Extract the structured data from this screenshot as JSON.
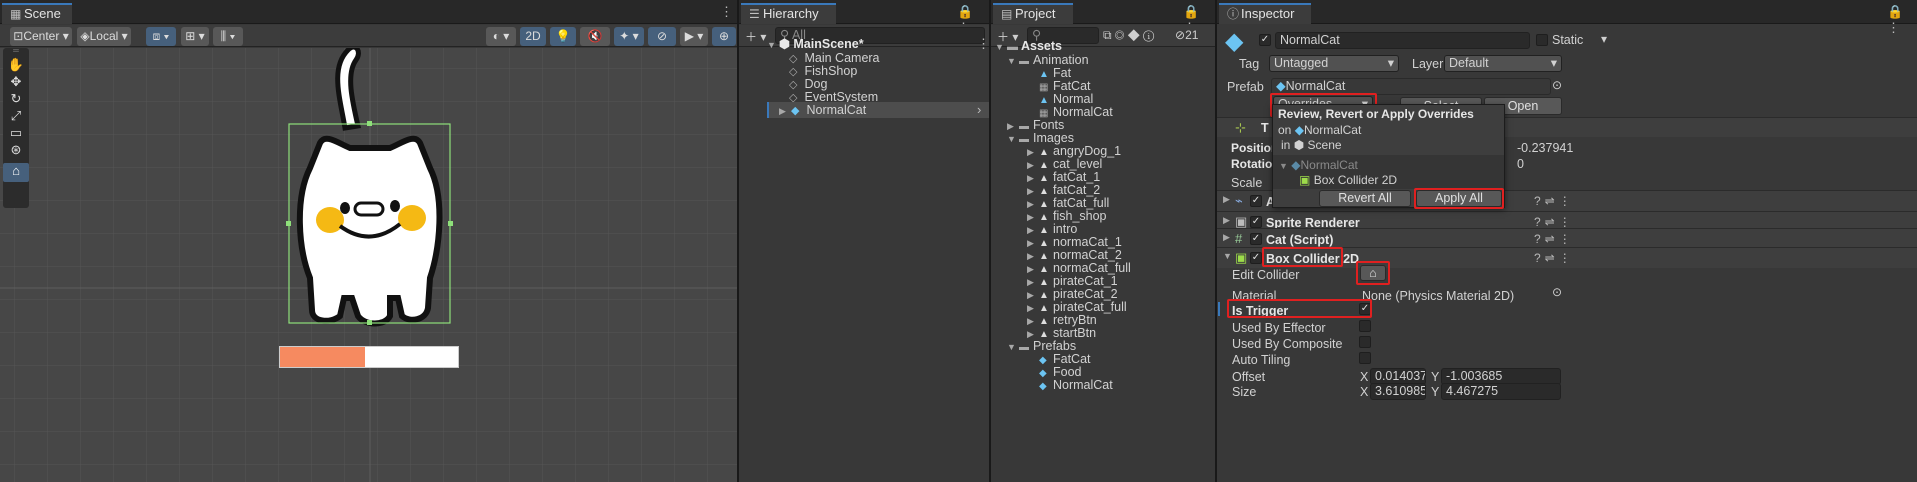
{
  "scene": {
    "tab": "Scene",
    "pivot": "Center",
    "space": "Local",
    "mode2d": "2D"
  },
  "hierarchy": {
    "tab": "Hierarchy",
    "search_placeholder": "All",
    "root": "MainScene*",
    "items": [
      "Main Camera",
      "FishShop",
      "Dog",
      "EventSystem",
      "NormalCat"
    ]
  },
  "project": {
    "tab": "Project",
    "count": "21",
    "assets": "Assets",
    "tree": [
      {
        "label": "Animation",
        "type": "folder",
        "indent": 1,
        "open": true
      },
      {
        "label": "Fat",
        "type": "anim",
        "indent": 2
      },
      {
        "label": "FatCat",
        "type": "ctrl",
        "indent": 2
      },
      {
        "label": "Normal",
        "type": "anim",
        "indent": 2
      },
      {
        "label": "NormalCat",
        "type": "ctrl",
        "indent": 2
      },
      {
        "label": "Fonts",
        "type": "folder",
        "indent": 1,
        "open": false
      },
      {
        "label": "Images",
        "type": "folder",
        "indent": 1,
        "open": true
      },
      {
        "label": "angryDog_1",
        "type": "img",
        "indent": 2
      },
      {
        "label": "cat_level",
        "type": "img",
        "indent": 2
      },
      {
        "label": "fatCat_1",
        "type": "img",
        "indent": 2
      },
      {
        "label": "fatCat_2",
        "type": "img",
        "indent": 2
      },
      {
        "label": "fatCat_full",
        "type": "img",
        "indent": 2
      },
      {
        "label": "fish_shop",
        "type": "img",
        "indent": 2
      },
      {
        "label": "intro",
        "type": "img",
        "indent": 2
      },
      {
        "label": "normaCat_1",
        "type": "img",
        "indent": 2
      },
      {
        "label": "normaCat_2",
        "type": "img",
        "indent": 2
      },
      {
        "label": "normaCat_full",
        "type": "img",
        "indent": 2
      },
      {
        "label": "pirateCat_1",
        "type": "img",
        "indent": 2
      },
      {
        "label": "pirateCat_2",
        "type": "img",
        "indent": 2
      },
      {
        "label": "pirateCat_full",
        "type": "img",
        "indent": 2
      },
      {
        "label": "retryBtn",
        "type": "img",
        "indent": 2
      },
      {
        "label": "startBtn",
        "type": "img",
        "indent": 2
      },
      {
        "label": "Prefabs",
        "type": "folder",
        "indent": 1,
        "open": true
      },
      {
        "label": "FatCat",
        "type": "prefab",
        "indent": 2
      },
      {
        "label": "Food",
        "type": "prefab",
        "indent": 2
      },
      {
        "label": "NormalCat",
        "type": "prefab",
        "indent": 2
      }
    ]
  },
  "inspector": {
    "tab": "Inspector",
    "name": "NormalCat",
    "static": "Static",
    "tag_label": "Tag",
    "tag_value": "Untagged",
    "layer_label": "Layer",
    "layer_value": "Default",
    "prefab_label": "Prefab",
    "prefab_value": "NormalCat",
    "overrides": "Overrides",
    "select": "Select",
    "open": "Open",
    "popup": {
      "title": "Review, Revert or Apply Overrides",
      "on_prefix": "on",
      "on_value": "NormalCat",
      "in_prefix": "in",
      "in_value": "Scene",
      "tree_root": "NormalCat",
      "tree_child": "Box Collider 2D",
      "revert": "Revert All",
      "apply": "Apply All"
    },
    "transform": {
      "position_label": "Position",
      "position_tail": "-0.237941",
      "rotation_label": "Rotation",
      "rotation_tail": "0",
      "scale_label": "Scale",
      "title_tail": "T"
    },
    "components": {
      "animator": "A",
      "sprite": "Sprite Renderer",
      "script": "Cat (Script)",
      "collider": "Box Collider 2D"
    },
    "collider": {
      "edit_label": "Edit Collider",
      "material_label": "Material",
      "material_value": "None (Physics Material 2D)",
      "trigger_label": "Is Trigger",
      "effector_label": "Used By Effector",
      "composite_label": "Used By Composite",
      "tiling_label": "Auto Tiling",
      "offset_label": "Offset",
      "offset_x": "0.0140372",
      "offset_y": "-1.003685",
      "size_label": "Size",
      "size_x": "3.610985",
      "size_y": "4.467275",
      "x": "X",
      "y": "Y"
    }
  },
  "progress": {
    "fraction": 0.48
  },
  "colors": {
    "accent": "#3a79bb",
    "highlight": "#e02020",
    "cyan_icon": "#6cc4f2"
  }
}
